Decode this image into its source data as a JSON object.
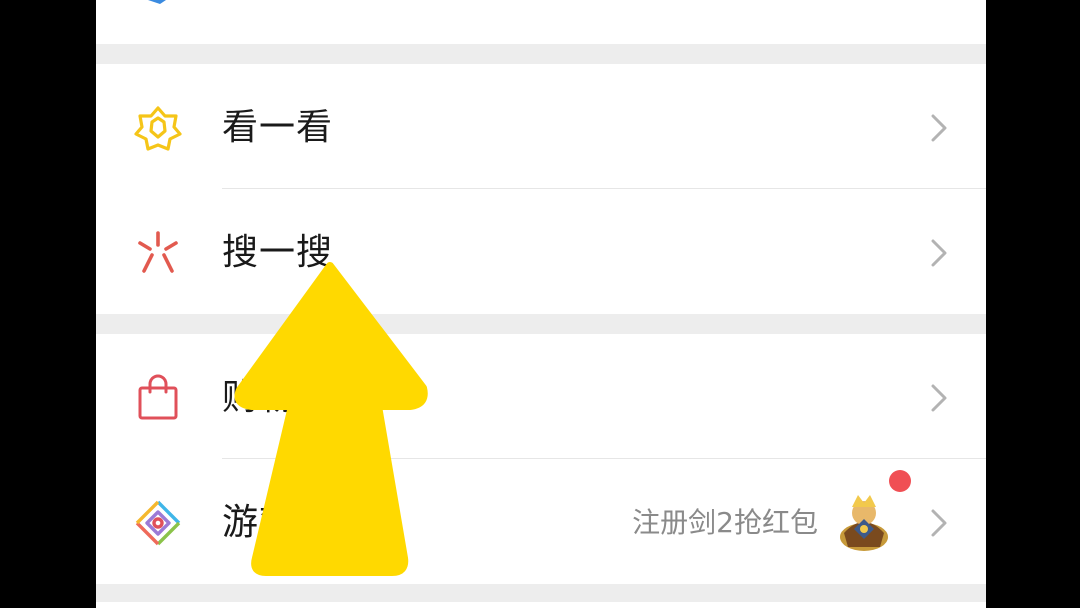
{
  "menu": {
    "items": [
      {
        "label": "看一看",
        "icon": "look-icon"
      },
      {
        "label": "搜一搜",
        "icon": "search-icon"
      },
      {
        "label": "购物",
        "icon": "shopping-bag-icon"
      },
      {
        "label": "游戏",
        "icon": "game-icon",
        "promo_text": "注册剑2抢红包",
        "has_badge": true
      }
    ]
  },
  "colors": {
    "background": "#ededed",
    "card": "#ffffff",
    "text": "#1a1a1a",
    "secondary_text": "#8a8a8a",
    "look_icon": "#f5c518",
    "search_icon": "#e25a4f",
    "shopping_icon": "#e0505a",
    "badge": "#f04f54",
    "overlay_arrow": "#ffd900",
    "frame": "#000000"
  }
}
